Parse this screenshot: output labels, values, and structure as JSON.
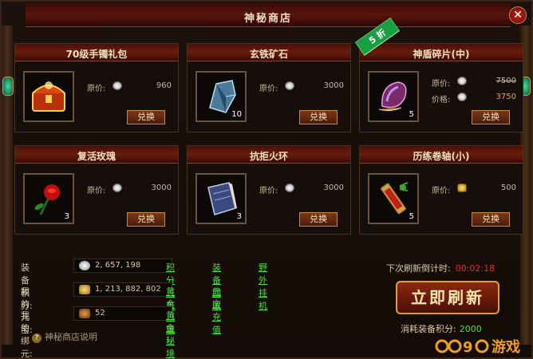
{
  "window": {
    "title": "神秘商店",
    "close_label": "✕"
  },
  "cards": [
    {
      "name": "70级手镯礼包",
      "qty": "",
      "rows": [
        {
          "label": "原价:",
          "coin": "silver",
          "value": "960",
          "style": ""
        }
      ],
      "button": "兑换",
      "icon": "treasure-chest-icon"
    },
    {
      "name": "玄铁矿石",
      "qty": "10",
      "rows": [
        {
          "label": "原价:",
          "coin": "silver",
          "value": "3000",
          "style": ""
        }
      ],
      "button": "兑换",
      "icon": "ore-crystal-icon"
    },
    {
      "name": "神盾碎片(中)",
      "qty": "5",
      "badge": "5 折",
      "rows": [
        {
          "label": "原价:",
          "coin": "silver",
          "value": "7500",
          "style": "strike"
        },
        {
          "label": "价格:",
          "coin": "silver",
          "value": "3750",
          "style": "orange"
        }
      ],
      "button": "兑换",
      "icon": "shield-shard-icon"
    },
    {
      "name": "复活玫瑰",
      "qty": "3",
      "rows": [
        {
          "label": "原价:",
          "coin": "silver",
          "value": "3000",
          "style": ""
        }
      ],
      "button": "兑换",
      "icon": "rose-icon"
    },
    {
      "name": "抗拒火环",
      "qty": "3",
      "rows": [
        {
          "label": "原价:",
          "coin": "silver",
          "value": "3000",
          "style": ""
        }
      ],
      "button": "兑换",
      "icon": "skill-book-icon"
    },
    {
      "name": "历练卷轴(小)",
      "qty": "5",
      "rows": [
        {
          "label": "原价:",
          "coin": "gold",
          "value": "500",
          "style": ""
        }
      ],
      "button": "兑换",
      "icon": "scroll-icon"
    }
  ],
  "bottom": {
    "equip_points": {
      "label": "装备积分:",
      "value": "2, 657, 198"
    },
    "yuanbao": {
      "label": "我的元宝:",
      "value": "1, 213, 882, 802"
    },
    "bound": {
      "label": "我的绑元:",
      "value": "52"
    },
    "links_row1": [
      "积分任务",
      "装备回收",
      "野外挂机"
    ],
    "links_row2": [
      "黄金秘境",
      "元宝充值"
    ],
    "links_row3": [
      "黄金秘境"
    ],
    "help": "神秘商店说明",
    "timer_label": "下次刷新倒计时:",
    "timer_value": "00:02:18",
    "refresh_button": "立即刷新",
    "cost_label": "消耗装备积分:",
    "cost_value": "2000",
    "watermark": "游戏",
    "watermark_digits": "9"
  }
}
